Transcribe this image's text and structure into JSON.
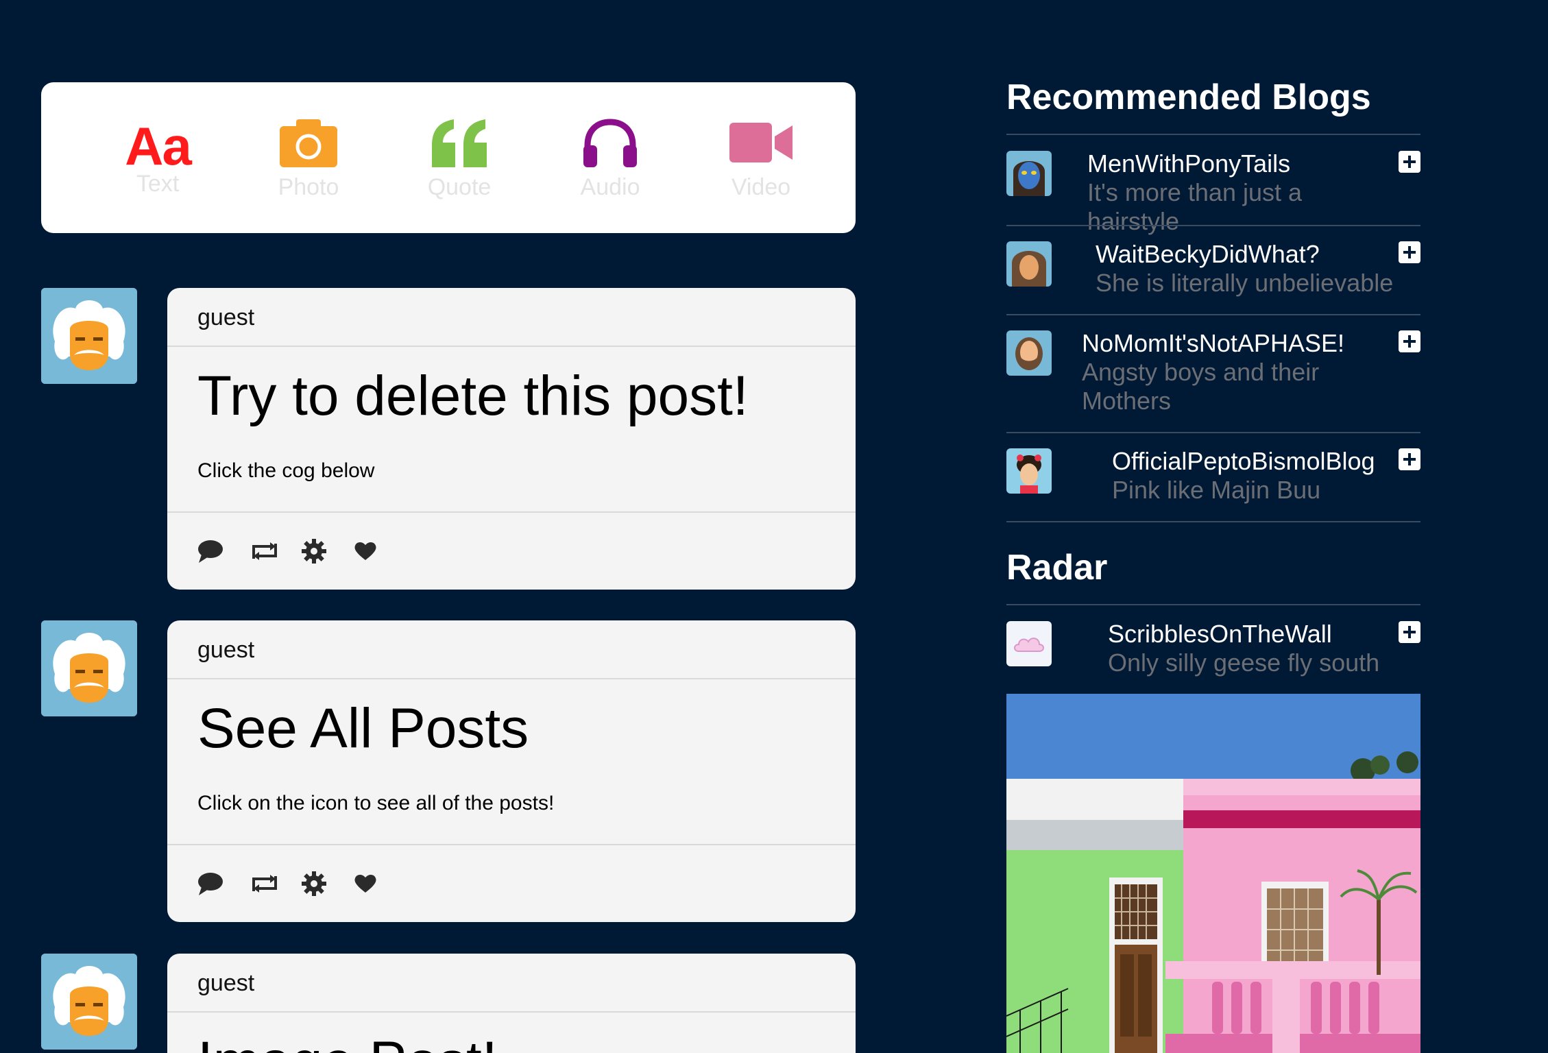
{
  "composer": {
    "items": [
      {
        "label": "Text",
        "icon": "text-aa-icon",
        "glyph": "Aa",
        "color": "#ff1b1b"
      },
      {
        "label": "Photo",
        "icon": "camera-icon",
        "color": "#f7a02a"
      },
      {
        "label": "Quote",
        "icon": "quote-icon",
        "color": "#7fc24a"
      },
      {
        "label": "Audio",
        "icon": "headphones-icon",
        "color": "#8b0f8b"
      },
      {
        "label": "Video",
        "icon": "video-camera-icon",
        "color": "#dc6e97"
      }
    ]
  },
  "posts": [
    {
      "user": "guest",
      "title": "Try to delete this post!",
      "text": "Click the cog below"
    },
    {
      "user": "guest",
      "title": "See All Posts",
      "text": "Click on the icon to see all of the posts!"
    },
    {
      "user": "guest",
      "title": "Image Post!",
      "text": ""
    }
  ],
  "post_actions": [
    "comment-icon",
    "reblog-icon",
    "cog-icon",
    "heart-icon"
  ],
  "sidebar": {
    "recommended_heading": "Recommended Blogs",
    "recommended": [
      {
        "name": "MenWithPonyTails",
        "tagline": "It's more than just a hairstyle"
      },
      {
        "name": "WaitBeckyDidWhat?",
        "tagline": "She is literally unbelievable"
      },
      {
        "name": "NoMomIt'sNotAPHASE!",
        "tagline": "Angsty boys and their Mothers"
      },
      {
        "name": "OfficialPeptoBismolBlog",
        "tagline": "Pink like Majin Buu"
      }
    ],
    "radar_heading": "Radar",
    "radar": {
      "name": "ScribblesOnTheWall",
      "tagline": "Only silly geese fly south"
    }
  },
  "colors": {
    "background": "#001935",
    "card": "#f4f4f4",
    "composer": "#ffffff",
    "avatar_bg": "#77b9d7",
    "muted_text": "#6b6f75"
  }
}
